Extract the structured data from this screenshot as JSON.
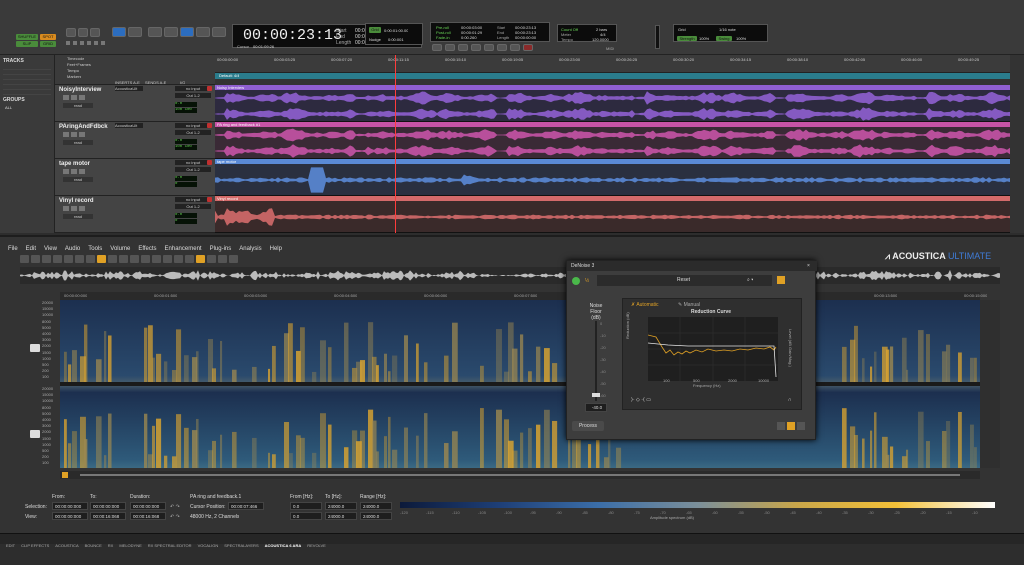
{
  "transport": {
    "mode_shuffle": "SHUFFLE",
    "mode_spot": "SPOT",
    "mode_slip": "SLIP",
    "mode_grid": "GRID",
    "main_counter": "00:00:23:13",
    "counter_arrow": "▾",
    "start_label": "Start",
    "end_label": "End",
    "length_label": "Length",
    "start_val": "00:00:18:07",
    "end_val": "00:00:23:24",
    "length_val": "00:00:05:01",
    "cursor_label": "Cursor",
    "cursor_val": "00:01:09:26",
    "nudge_label": "Nudge",
    "nudge_val": "0:00:001",
    "grid_label": "Grid",
    "grid_val": "0:00:01:00.00",
    "preroll_label": "Pre-roll",
    "postroll_label": "Post-roll",
    "fadein_label": "Fade-in",
    "preroll_val": "00:00:03:00",
    "postroll_val": "00:00:01:29",
    "fadein_val": "0:00.260",
    "sub_start_val": "00:00:23:13",
    "sub_end_val": "00:00:23:13",
    "sub_length_val": "00:00:00:00",
    "count_off": "Count Off",
    "meter_label": "Meter",
    "tempo_label": "Tempo",
    "count_val": "2 bars",
    "meter_val": "4/4",
    "tempo_val": "120.0000",
    "grid2_label": "Grid",
    "grid2_val": "1/16 note",
    "strength_label": "Strength",
    "strength_val": "100%",
    "swing_label": "Swing",
    "swing_val": "100%",
    "midi_label": "MIDI"
  },
  "left": {
    "tracks_title": "TRACKS",
    "groups_title": "GROUPS",
    "group_item": "ALL"
  },
  "rulers": {
    "timecode": "Timecode",
    "markers": "Markers",
    "tempo": "Tempo",
    "samples": "Samples",
    "feet": "Feet+Frames",
    "marker_label": "Default: 4/4",
    "ticks": [
      "00:00:00:00",
      "00:00:03:25",
      "00:00:07:20",
      "00:00:11:15",
      "00:00:15:10",
      "00:00:19:05",
      "00:00:23:00",
      "00:00:26:25",
      "00:00:30:20",
      "00:00:34:15",
      "00:00:38:10",
      "00:00:42:05",
      "00:00:46:00",
      "00:00:49:25"
    ]
  },
  "tracks": [
    {
      "name": "NoisyInterview",
      "clip": "Noisy Interview",
      "color": "#8f5fd0",
      "bg": "#2d2a3f",
      "waveform": "read",
      "input": "no input",
      "out": "Out 1-2",
      "vol": "0.0",
      "pan": "100 100",
      "insert": "AcousticaUlt"
    },
    {
      "name": "PAringAndFdbck",
      "clip": "PA ring and feedback #1",
      "color": "#c653a6",
      "bg": "#3a2a36",
      "waveform": "read",
      "input": "no input",
      "out": "Out 1-2",
      "vol": "0.0",
      "pan": "100 100",
      "insert": "AcousticaUlt"
    },
    {
      "name": "tape motor",
      "clip": "tape motor",
      "color": "#5a8ad6",
      "bg": "#2a3040",
      "waveform": "read",
      "input": "no input",
      "out": "Out 1-2",
      "vol": "0.0",
      "pan": "0",
      "insert": ""
    },
    {
      "name": "Vinyl record",
      "clip": "Vinyl record",
      "color": "#d46a6a",
      "bg": "#3a2a2a",
      "waveform": "read",
      "input": "no input",
      "out": "Out 1-2",
      "vol": "0.0",
      "pan": "0",
      "insert": ""
    }
  ],
  "io_headers": {
    "inserts": "INSERTS A-E",
    "sends": "SENDS A-E",
    "io": "I/O"
  },
  "acoustica": {
    "menu": [
      "File",
      "Edit",
      "View",
      "Audio",
      "Tools",
      "Volume",
      "Effects",
      "Enhancement",
      "Plug-ins",
      "Analysis",
      "Help"
    ],
    "brand": "ACOUSTICA",
    "brand_suffix": "ULTIMATE",
    "timeline": [
      "00:00:00:000",
      "00:00:01:500",
      "00:00:03:000",
      "00:00:04:500",
      "00:00:06:000",
      "00:00:07:500",
      "00:00:09:000",
      "00:00:10:500",
      "00:00:12:000",
      "00:00:13:500",
      "00:00:15:000"
    ],
    "freq_labels": [
      "20000",
      "15000",
      "10000",
      "8000",
      "5000",
      "4000",
      "3000",
      "2000",
      "1500",
      "1000",
      "500",
      "200",
      "100"
    ],
    "selection": {
      "from_label": "From:",
      "to_label": "To:",
      "duration_label": "Duration:",
      "sel_label": "Selection:",
      "view_label": "View:",
      "sel_from": "00:00:00:000",
      "sel_to": "00:00:00:000",
      "sel_dur": "00:00:00:000",
      "view_from": "00:00:00:000",
      "view_to": "00:00:16:068",
      "view_dur": "00:00:16:068",
      "file_name": "PA ring and feedback.1",
      "cursor_label": "Cursor Position:",
      "cursor_val": "00:00:07:466",
      "format": "48000 Hz, 2 Channels",
      "fromhz_label": "From [Hz]:",
      "tohz_label": "To [Hz]:",
      "range_label": "Range [Hz]:",
      "sel_fromhz": "0.0",
      "sel_tohz": "24000.0",
      "sel_range": "24000.0",
      "view_fromhz": "0.0",
      "view_tohz": "24000.0",
      "view_range": "24000.0",
      "amp_label": "Amplitude spectrum (dB)"
    },
    "colorbar_ticks": [
      "-120",
      "-115",
      "-110",
      "-105",
      "-100",
      "-95",
      "-90",
      "-85",
      "-80",
      "-75",
      "-70",
      "-65",
      "-60",
      "-55",
      "-50",
      "-45",
      "-40",
      "-35",
      "-30",
      "-25",
      "-20",
      "-15",
      "-10"
    ]
  },
  "denoise": {
    "title": "DeNoise 3",
    "preset": "Reset",
    "noise_floor_label": "Noise Floor (dB)",
    "noise_val": "-40.0",
    "automatic": "Automatic",
    "manual": "Manual",
    "curve_title": "Reduction Curve",
    "freq_axis": "Frequency (Hz)",
    "y_left": "Reduction (dB)",
    "y_right": "Level (dB Gain/Mag.)",
    "x_ticks": [
      "100",
      "500",
      "2000",
      "10000"
    ],
    "y_ticks": [
      "0",
      "-10",
      "-20",
      "-30",
      "-40",
      "-50",
      "-60"
    ],
    "process": "Process",
    "ylevels": [
      "0",
      "-10",
      "-20",
      "-30",
      "-40",
      "-50",
      "-60",
      "-70",
      "-80",
      "-90"
    ]
  },
  "status_tabs": [
    "EDIT",
    "CLIP EFFECTS",
    "ACOUSTICA",
    "BOUNCE",
    "RX",
    "MELODYNE",
    "RX SPECTRAL EDITOR",
    "VOCALIGN",
    "SPECTRALAYERS",
    "ACOUSTICA 6 ARA",
    "REVOLVE"
  ]
}
